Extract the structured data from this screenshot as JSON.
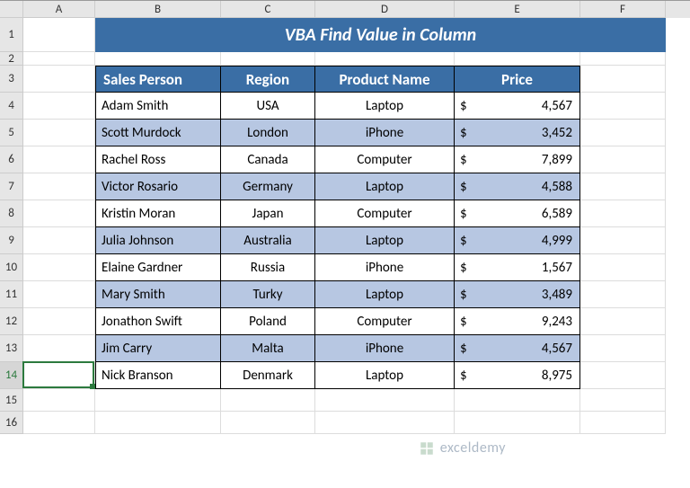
{
  "columns": [
    "A",
    "B",
    "C",
    "D",
    "E",
    "F"
  ],
  "col_widths": {
    "rowhdr": 26,
    "A": 80,
    "B": 140,
    "C": 105,
    "D": 155,
    "E": 140,
    "F": 95
  },
  "row_heights": {
    "default": 30,
    "r1": 38,
    "r2": 15,
    "r15": 25,
    "r16": 25
  },
  "title": "VBA Find Value in Column",
  "headers": {
    "B": "Sales Person",
    "C": "Region",
    "D": "Product Name",
    "E": "Price"
  },
  "rows": [
    {
      "person": "Adam Smith",
      "region": "USA",
      "product": "Laptop",
      "price": "4,567",
      "shade": false
    },
    {
      "person": "Scott Murdock",
      "region": "London",
      "product": "iPhone",
      "price": "3,452",
      "shade": true
    },
    {
      "person": "Rachel Ross",
      "region": "Canada",
      "product": "Computer",
      "price": "7,899",
      "shade": false
    },
    {
      "person": "Victor Rosario",
      "region": "Germany",
      "product": "Laptop",
      "price": "4,588",
      "shade": true
    },
    {
      "person": "Kristin Moran",
      "region": "Japan",
      "product": "Computer",
      "price": "6,589",
      "shade": false
    },
    {
      "person": "Julia Johnson",
      "region": "Australia",
      "product": "Laptop",
      "price": "4,999",
      "shade": true
    },
    {
      "person": "Elaine Gardner",
      "region": "Russia",
      "product": "iPhone",
      "price": "1,567",
      "shade": false
    },
    {
      "person": "Mary Smith",
      "region": "Turky",
      "product": "Laptop",
      "price": "3,489",
      "shade": true
    },
    {
      "person": "Jonathon Swift",
      "region": "Poland",
      "product": "Computer",
      "price": "9,243",
      "shade": false
    },
    {
      "person": "Jim Carry",
      "region": "Malta",
      "product": "iPhone",
      "price": "4,567",
      "shade": true
    },
    {
      "person": "Nick Branson",
      "region": "Denmark",
      "product": "Laptop",
      "price": "8,975",
      "shade": false
    }
  ],
  "currency_symbol": "$",
  "active_cell": {
    "row": 14,
    "col": "A"
  },
  "watermark": "exceldemy"
}
